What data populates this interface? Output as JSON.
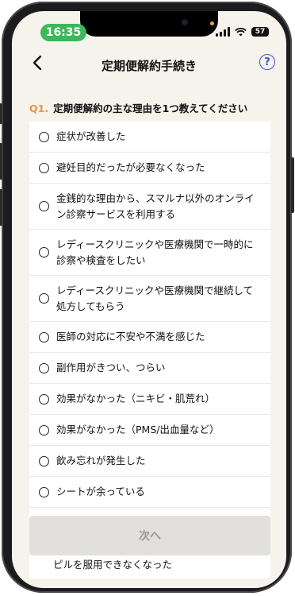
{
  "status_bar": {
    "time": "16:35",
    "battery": "57"
  },
  "header": {
    "title": "定期便解約手続き",
    "help": "?"
  },
  "question": {
    "number": "Q1.",
    "text": "定期便解約の主な理由を1つ教えてください"
  },
  "options": [
    "症状が改善した",
    "避妊目的だったが必要なくなった",
    "金銭的な理由から、スマルナ以外のオンライン診察サービスを利用する",
    "レディースクリニックや医療機関で一時的に診察や検査をしたい",
    "レディースクリニックや医療機関で継続して処方してもらう",
    "医師の対応に不安や不満を感じた",
    "副作用がきつい、つらい",
    "効果がなかった（ニキビ・肌荒れ）",
    "効果がなかった（PMS/出血量など）",
    "飲み忘れが発生した",
    "シートが余っている"
  ],
  "partial_option": "ピルを服用できなくなった",
  "footer": {
    "next_label": "次へ"
  }
}
